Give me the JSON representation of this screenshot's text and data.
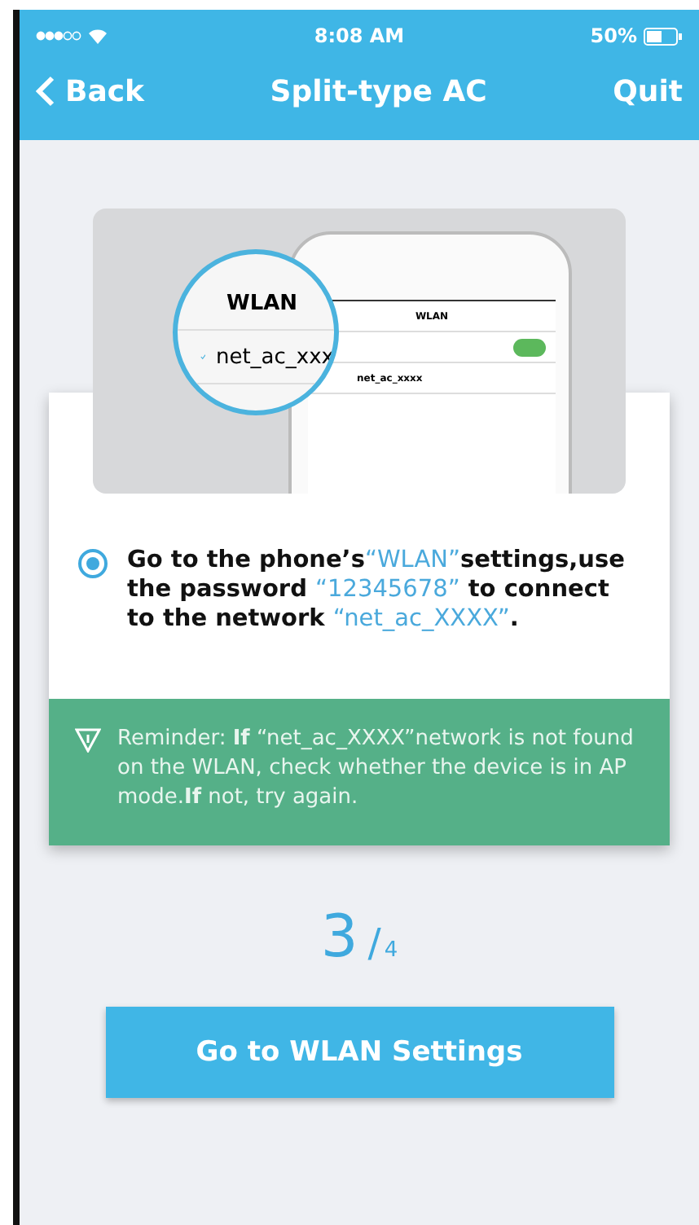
{
  "status_bar": {
    "time": "8:08 AM",
    "battery": "50%"
  },
  "nav": {
    "back": "Back",
    "title": "Split-type AC",
    "quit": "Quit"
  },
  "illustration": {
    "magnifier": {
      "title": "WLAN",
      "network": "net_ac_xxx"
    },
    "phone": {
      "title": "WLAN",
      "network": "net_ac_xxxx",
      "wifi_on": true
    }
  },
  "instruction": {
    "selected": true,
    "segments": [
      {
        "kind": "plain",
        "text": "Go to the phone’s"
      },
      {
        "kind": "highlight",
        "text": "“WLAN”"
      },
      {
        "kind": "plain",
        "text": "settings,use the password "
      },
      {
        "kind": "highlight",
        "text": "“12345678”"
      },
      {
        "kind": "plain",
        "text": " to connect to the network "
      },
      {
        "kind": "highlight",
        "text": "“net_ac_XXXX”"
      },
      {
        "kind": "plain",
        "text": "."
      }
    ]
  },
  "reminder": {
    "text": "Reminder: **If** “net_ac_XXXX”network is not found on the WLAN, check whether the device is in AP mode.**If** not, try again."
  },
  "step": {
    "current": "3",
    "separator": "/",
    "total": "4"
  },
  "button": "Go to WLAN Settings"
}
